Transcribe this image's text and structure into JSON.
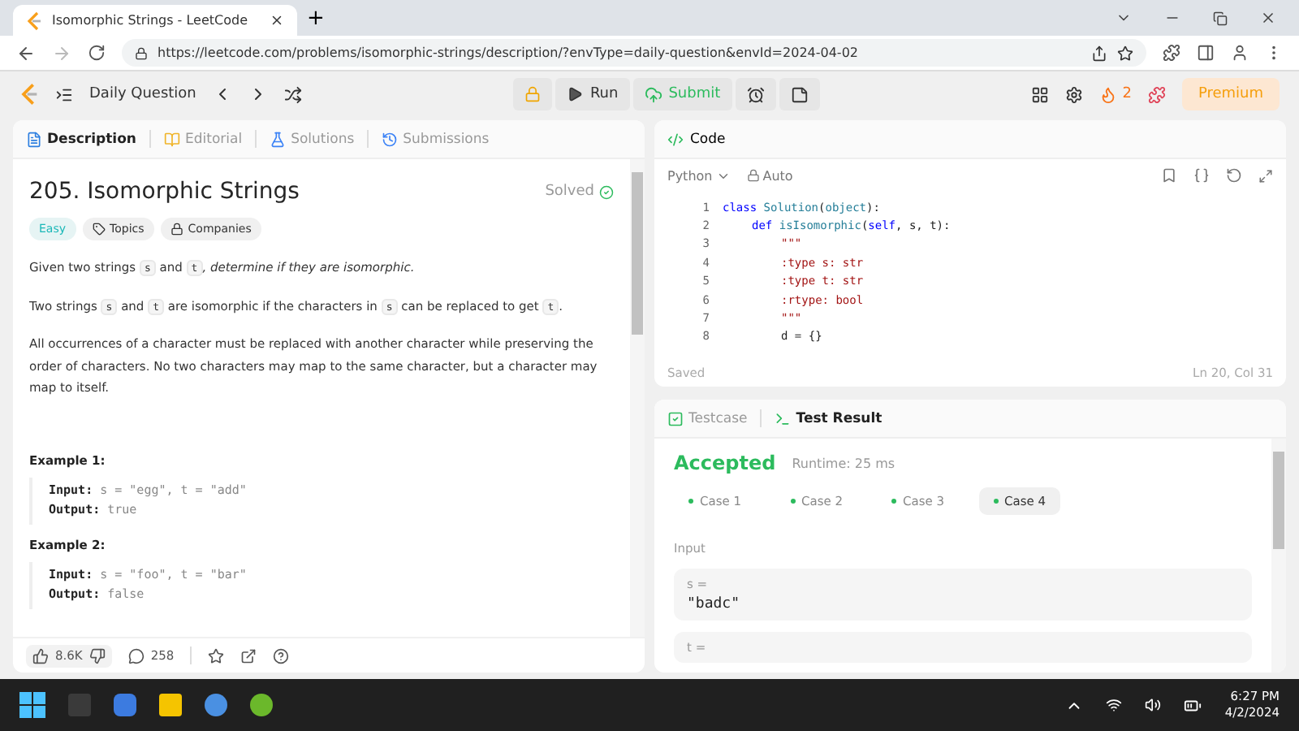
{
  "browser": {
    "tab_title": "Isomorphic Strings - LeetCode",
    "new_tab": "+",
    "url": "https://leetcode.com/problems/isomorphic-strings/description/?envType=daily-question&envId=2024-04-02"
  },
  "header": {
    "daily": "Daily Question",
    "run": "Run",
    "submit": "Submit",
    "streak": "2",
    "premium": "Premium"
  },
  "left_tabs": [
    {
      "label": "Description",
      "selected": true
    },
    {
      "label": "Editorial",
      "selected": false
    },
    {
      "label": "Solutions",
      "selected": false
    },
    {
      "label": "Submissions",
      "selected": false
    }
  ],
  "problem": {
    "title": "205. Isomorphic Strings",
    "status": "Solved",
    "difficulty": "Easy",
    "tags": [
      "Topics",
      "Companies"
    ],
    "paragraphs": [
      [
        {
          "kind": "plain",
          "text": "Given two strings "
        },
        {
          "kind": "code",
          "text": "s"
        },
        {
          "kind": "plain",
          "text": " and "
        },
        {
          "kind": "code",
          "text": "t"
        },
        {
          "kind": "italic",
          "text": ", determine if they are isomorphic."
        }
      ],
      [
        {
          "kind": "plain",
          "text": "Two strings "
        },
        {
          "kind": "code",
          "text": "s"
        },
        {
          "kind": "plain",
          "text": " and "
        },
        {
          "kind": "code",
          "text": "t"
        },
        {
          "kind": "plain",
          "text": " are isomorphic if the characters in "
        },
        {
          "kind": "code",
          "text": "s"
        },
        {
          "kind": "plain",
          "text": " can be replaced to get "
        },
        {
          "kind": "code",
          "text": "t"
        },
        {
          "kind": "plain",
          "text": "."
        }
      ],
      [
        {
          "kind": "plain",
          "text": "All occurrences of a character must be replaced with another character while preserving the order of characters. No two characters may map to the same character, but a character may map to itself."
        }
      ]
    ],
    "examples": [
      {
        "title": "Example 1:",
        "input_label": "Input:",
        "input": "s = \"egg\", t = \"add\"",
        "output_label": "Output:",
        "output": "true"
      },
      {
        "title": "Example 2:",
        "input_label": "Input:",
        "input": "s = \"foo\", t = \"bar\"",
        "output_label": "Output:",
        "output": "false"
      }
    ],
    "likes": "8.6K",
    "comments": "258"
  },
  "code": {
    "title": "Code",
    "language": "Python",
    "mode": "Auto",
    "saved": "Saved",
    "position": "Ln 20, Col 31",
    "lines": [
      {
        "no": "1",
        "tokens": [
          {
            "kind": "keyword",
            "text": "class "
          },
          {
            "kind": "name",
            "text": "Solution"
          },
          {
            "kind": "plain",
            "text": "("
          },
          {
            "kind": "name",
            "text": "object"
          },
          {
            "kind": "plain",
            "text": "):"
          }
        ],
        "children": [
          {
            "no": "2",
            "tokens": [
              {
                "kind": "keyword",
                "text": "def "
              },
              {
                "kind": "name",
                "text": "isIsomorphic"
              },
              {
                "kind": "plain",
                "text": "("
              },
              {
                "kind": "keyword",
                "text": "self"
              },
              {
                "kind": "plain",
                "text": ", s, t):"
              }
            ],
            "children": [
              {
                "no": "3",
                "tokens": [
                  {
                    "kind": "string",
                    "text": "\"\"\""
                  }
                ]
              },
              {
                "no": "4",
                "tokens": [
                  {
                    "kind": "string",
                    "text": ":type s: str"
                  }
                ]
              },
              {
                "no": "5",
                "tokens": [
                  {
                    "kind": "string",
                    "text": ":type t: str"
                  }
                ]
              },
              {
                "no": "6",
                "tokens": [
                  {
                    "kind": "string",
                    "text": ":rtype: bool"
                  }
                ]
              },
              {
                "no": "7",
                "tokens": [
                  {
                    "kind": "string",
                    "text": "\"\"\""
                  }
                ]
              },
              {
                "no": "8",
                "tokens": [
                  {
                    "kind": "plain",
                    "text": "d = {}"
                  }
                ]
              }
            ]
          }
        ]
      }
    ]
  },
  "result_tabs": [
    {
      "label": "Testcase",
      "selected": false
    },
    {
      "label": "Test Result",
      "selected": true
    }
  ],
  "result": {
    "verdict": "Accepted",
    "runtime": "Runtime: 25 ms",
    "cases": [
      {
        "label": "Case 1",
        "selected": false
      },
      {
        "label": "Case 2",
        "selected": false
      },
      {
        "label": "Case 3",
        "selected": false
      },
      {
        "label": "Case 4",
        "selected": true
      }
    ],
    "input_label": "Input",
    "inputs": [
      {
        "name": "s =",
        "value": "\"badc\""
      },
      {
        "name": "t ="
      }
    ]
  },
  "taskbar": {
    "time": "6:27 PM",
    "date": "4/2/2024"
  }
}
